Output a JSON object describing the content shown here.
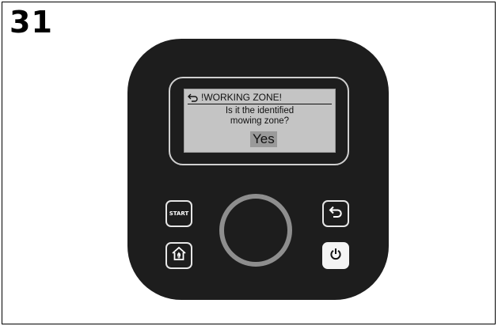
{
  "figure": {
    "step_number": "31"
  },
  "device": {
    "screen": {
      "title": "!WORKING ZONE!",
      "question_line1": "Is it the identified",
      "question_line2": "mowing zone?",
      "answer": "Yes"
    },
    "buttons": {
      "start_label": "START",
      "home_icon": "home-icon",
      "back_icon": "back-arrow-icon",
      "power_icon": "power-icon"
    },
    "dial_icon": "rotary-dial"
  },
  "colors": {
    "device_body": "#1d1d1d",
    "screen_bg": "#c4c4c4",
    "selection_bg": "#9a9a9a",
    "dial_ring": "#8e8e8e"
  }
}
